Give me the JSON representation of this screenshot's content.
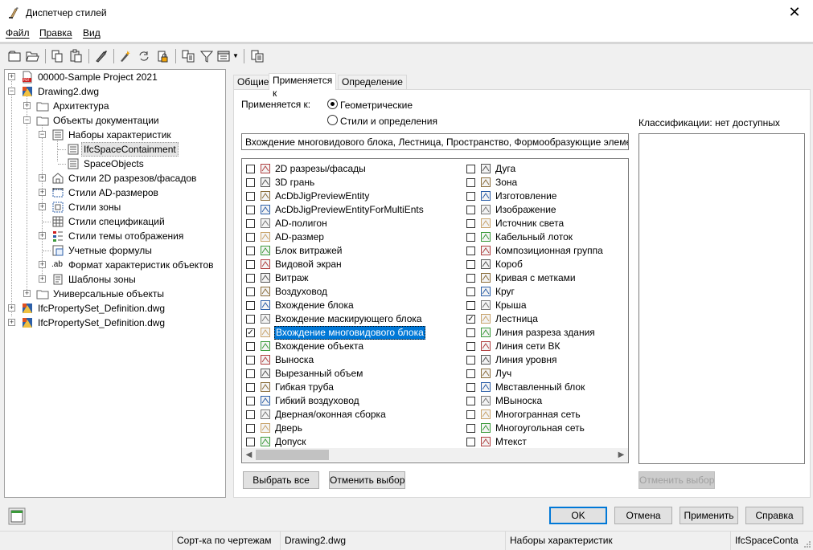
{
  "window": {
    "title": "Диспетчер стилей",
    "close_glyph": "✕"
  },
  "menu": [
    "Файл",
    "Правка",
    "Вид"
  ],
  "toolbar_icons": [
    "new-icon",
    "open-icon",
    "copy-icon",
    "paste-icon",
    "purge-icon",
    "edit-icon",
    "sync-icon",
    "lock-icon",
    "compare-icon",
    "filter-icon",
    "view-icon",
    "help-icon"
  ],
  "tree": [
    {
      "label": "00000-Sample Project 2021",
      "icon": "pdf-icon"
    },
    {
      "label": "Drawing2.dwg",
      "icon": "drawing-icon"
    },
    {
      "label": "Архитектура",
      "icon": "folder-icon"
    },
    {
      "label": "Объекты документации",
      "icon": "folder-icon"
    },
    {
      "label": "Наборы характеристик",
      "icon": "property-set-icon"
    },
    {
      "label": "IfcSpaceContainment",
      "icon": "property-set-icon"
    },
    {
      "label": "SpaceObjects",
      "icon": "property-set-icon"
    },
    {
      "label": "Стили 2D разрезов/фасадов",
      "icon": "section-style-icon"
    },
    {
      "label": "Стили AD-размеров",
      "icon": "dimension-style-icon"
    },
    {
      "label": "Стили зоны",
      "icon": "zone-style-icon"
    },
    {
      "label": "Стили спецификаций",
      "icon": "schedule-style-icon"
    },
    {
      "label": "Стили темы отображения",
      "icon": "display-theme-icon"
    },
    {
      "label": "Учетные формулы",
      "icon": "formula-icon"
    },
    {
      "label": "Формат характеристик объектов",
      "icon": "format-icon"
    },
    {
      "label": "Шаблоны зоны",
      "icon": "zone-template-icon"
    },
    {
      "label": "Универсальные объекты",
      "icon": "folder-icon"
    },
    {
      "label": "IfcPropertySet_Definition.dwg",
      "icon": "drawing-icon"
    },
    {
      "label": "IfcPropertySet_Definition.dwg",
      "icon": "drawing-icon"
    }
  ],
  "tabs": [
    "Общие",
    "Применяется к",
    "Определение"
  ],
  "applies_to": {
    "label": "Применяется к:",
    "radio_geometric": "Геометрические",
    "radio_styles": "Стили и определения",
    "selected": "Геометрические",
    "summary": "Вхождение многовидового блока, Лестница, Пространство, Формообразующие элементы",
    "classifications_label": "Классификации: нет доступных"
  },
  "objects_col1": [
    {
      "label": "2D разрезы/фасады",
      "checked": false
    },
    {
      "label": "3D грань",
      "checked": false
    },
    {
      "label": "AcDbJigPreviewEntity",
      "checked": false
    },
    {
      "label": "AcDbJigPreviewEntityForMultiEnts",
      "checked": false
    },
    {
      "label": "AD-полигон",
      "checked": false
    },
    {
      "label": "AD-размер",
      "checked": false
    },
    {
      "label": "Блок витражей",
      "checked": false
    },
    {
      "label": "Видовой экран",
      "checked": false
    },
    {
      "label": "Витраж",
      "checked": false
    },
    {
      "label": "Воздуховод",
      "checked": false
    },
    {
      "label": "Вхождение блока",
      "checked": false
    },
    {
      "label": "Вхождение маскирующего блока",
      "checked": false
    },
    {
      "label": "Вхождение многовидового блока",
      "checked": true
    },
    {
      "label": "Вхождение объекта",
      "checked": false
    },
    {
      "label": "Выноска",
      "checked": false
    },
    {
      "label": "Вырезанный объем",
      "checked": false
    },
    {
      "label": "Гибкая труба",
      "checked": false
    },
    {
      "label": "Гибкий воздуховод",
      "checked": false
    },
    {
      "label": "Дверная/оконная сборка",
      "checked": false
    },
    {
      "label": "Дверь",
      "checked": false
    },
    {
      "label": "Допуск",
      "checked": false
    }
  ],
  "objects_col2": [
    {
      "label": "Дуга",
      "checked": false
    },
    {
      "label": "Зона",
      "checked": false
    },
    {
      "label": "Изготовление",
      "checked": false
    },
    {
      "label": "Изображение",
      "checked": false
    },
    {
      "label": "Источник света",
      "checked": false
    },
    {
      "label": "Кабельный лоток",
      "checked": false
    },
    {
      "label": "Композиционная группа",
      "checked": false
    },
    {
      "label": "Короб",
      "checked": false
    },
    {
      "label": "Кривая с метками",
      "checked": false
    },
    {
      "label": "Круг",
      "checked": false
    },
    {
      "label": "Крыша",
      "checked": false
    },
    {
      "label": "Лестница",
      "checked": true
    },
    {
      "label": "Линия разреза здания",
      "checked": false
    },
    {
      "label": "Линия сети ВК",
      "checked": false
    },
    {
      "label": "Линия уровня",
      "checked": false
    },
    {
      "label": "Луч",
      "checked": false
    },
    {
      "label": "Мвставленный блок",
      "checked": false
    },
    {
      "label": "МВыноска",
      "checked": false
    },
    {
      "label": "Многогранная сеть",
      "checked": false
    },
    {
      "label": "Многоугольная сеть",
      "checked": false
    },
    {
      "label": "Мтекст",
      "checked": false
    }
  ],
  "buttons": {
    "select_all": "Выбрать все",
    "clear_selection": "Отменить выбор",
    "clear_classification": "Отменить выбор",
    "ok": "OK",
    "cancel": "Отмена",
    "apply": "Применить",
    "help": "Справка"
  },
  "status": {
    "sort": "Сорт-ка по чертежам",
    "drawing": "Drawing2.dwg",
    "category": "Наборы характеристик",
    "item": "IfcSpaceConta"
  },
  "colors": {
    "accent": "#0078d7",
    "selection": "#0078d7"
  }
}
